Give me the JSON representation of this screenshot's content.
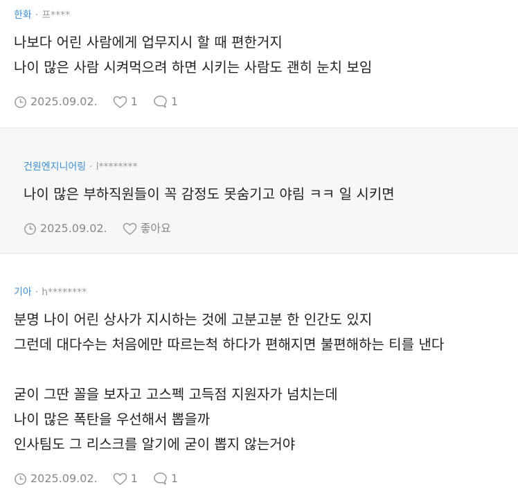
{
  "comments": [
    {
      "company": "한화",
      "separator": "·",
      "nickname": "프****",
      "lines": [
        "나보다 어린 사람에게 업무지시 할 때 편한거지",
        "나이 많은 사람 시켜먹으려 하면 시키는 사람도 괜히 눈치 보임"
      ],
      "date": "2025.09.02.",
      "likes": "1",
      "replies": "1"
    },
    {
      "company": "건원엔지니어링",
      "separator": "·",
      "nickname": "l********",
      "lines": [
        "나이 많은 부하직원들이 꼭 감정도 못숨기고 야림 ㅋㅋ 일 시키면"
      ],
      "date": "2025.09.02.",
      "like_label": "좋아요"
    },
    {
      "company": "기아",
      "separator": "·",
      "nickname": "h********",
      "lines": [
        "분명 나이 어린 상사가 지시하는 것에 고분고분 한 인간도 있지",
        "그런데 대다수는 처음에만 따르는척 하다가 편해지면 불편해하는 티를 낸다",
        "",
        "굳이 그딴 꼴을 보자고 고스펙 고득점 지원자가 넘치는데",
        "나이 많은 폭탄을 우선해서 뽑을까",
        "인사팀도 그 리스크를 알기에 굳이 뽑지 않는거야"
      ],
      "date": "2025.09.02.",
      "likes": "1",
      "replies": "1"
    }
  ],
  "icons": {
    "time": "clock-icon",
    "like": "heart-icon",
    "reply": "speech-bubble-icon"
  },
  "colors": {
    "company": "#3a8fd0",
    "muted": "#888888",
    "reply_background": "#f7f7f8"
  }
}
